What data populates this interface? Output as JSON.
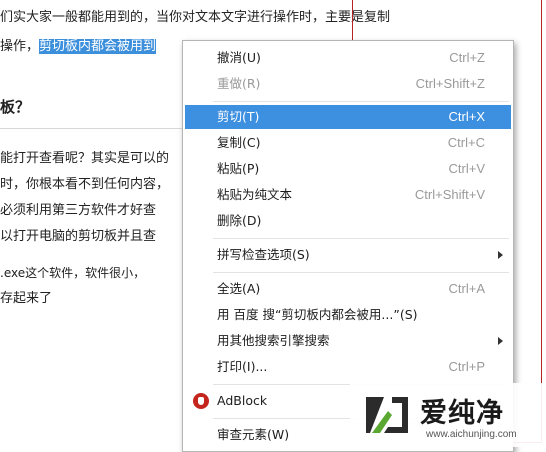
{
  "article": {
    "line1": "们实大家一般都能用到的，当你对文本文字进行操作时，主要是复制",
    "line2_prefix": "操作，",
    "line2_selected": "剪切板内都会被用到",
    "heading": "板？",
    "line3": "能打开查看呢？其实是可以的",
    "line4": "时，你根本看不到任何内容，",
    "line5": "必须利用第三方软件才好查",
    "line6": "以打开电脑的剪切板并且查",
    "line7": ".exe这个软件，软件很小，",
    "line8": "存起来了"
  },
  "menu": {
    "undo": {
      "label": "撤消(U)",
      "shortcut": "Ctrl+Z"
    },
    "redo": {
      "label": "重做(R)",
      "shortcut": "Ctrl+Shift+Z"
    },
    "cut": {
      "label": "剪切(T)",
      "shortcut": "Ctrl+X"
    },
    "copy": {
      "label": "复制(C)",
      "shortcut": "Ctrl+C"
    },
    "paste": {
      "label": "粘贴(P)",
      "shortcut": "Ctrl+V"
    },
    "paste_plain": {
      "label": "粘贴为纯文本",
      "shortcut": "Ctrl+Shift+V"
    },
    "delete": {
      "label": "删除(D)"
    },
    "spellcheck": {
      "label": "拼写检查选项(S)"
    },
    "select_all": {
      "label": "全选(A)",
      "shortcut": "Ctrl+A"
    },
    "baidu_search": {
      "label": "用 百度 搜“剪切板内都会被用...”(S)"
    },
    "other_search": {
      "label": "用其他搜索引擎搜索"
    },
    "print": {
      "label": "打印(I)...",
      "shortcut": "Ctrl+P"
    },
    "adblock": {
      "label": "AdBlock"
    },
    "inspect": {
      "label": "审查元素(W)"
    },
    "hovered_item": "cut",
    "accent_color": "#3d8fe0"
  },
  "watermark": {
    "text": "爱纯净",
    "url": "www.aichunjing.com"
  }
}
